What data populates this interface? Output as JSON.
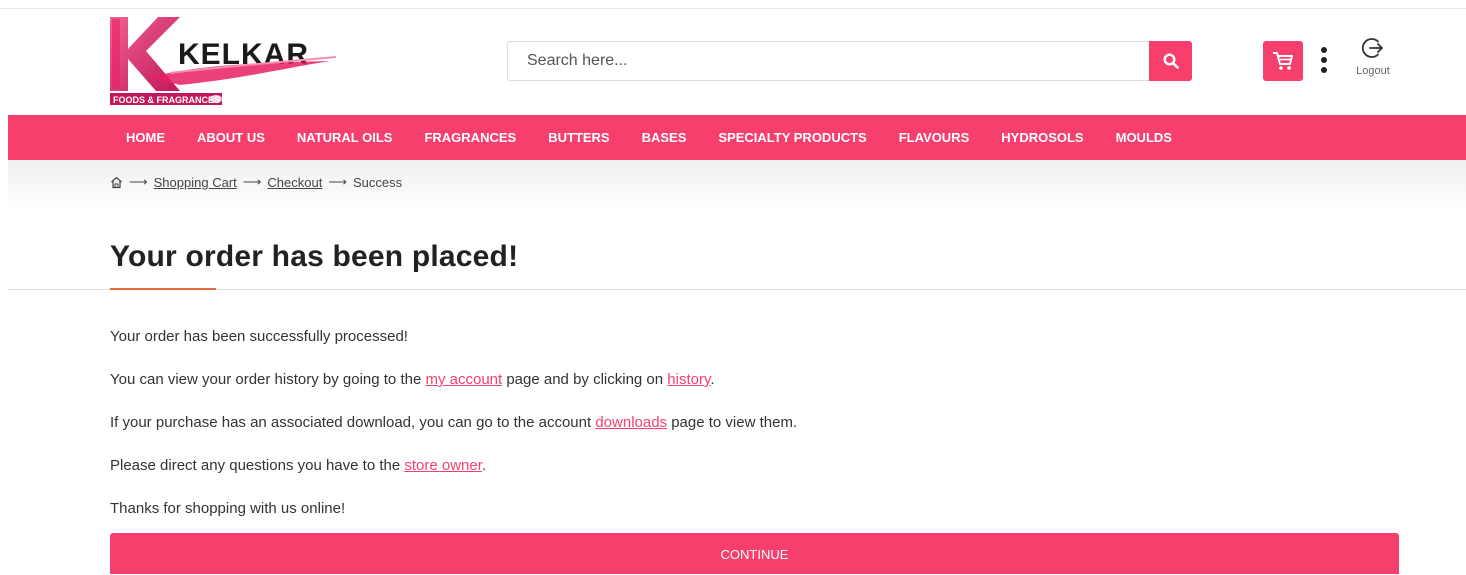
{
  "header": {
    "logo_text": "KELKAR",
    "logo_tagline": "FOODS & FRAGRANCES",
    "search_placeholder": "Search here...",
    "logout_label": "Logout"
  },
  "nav": {
    "items": [
      "HOME",
      "ABOUT US",
      "NATURAL OILS",
      "FRAGRANCES",
      "BUTTERS",
      "BASES",
      "SPECIALTY PRODUCTS",
      "FLAVOURS",
      "HYDROSOLS",
      "MOULDS"
    ]
  },
  "breadcrumb": {
    "items": [
      "Shopping Cart",
      "Checkout",
      "Success"
    ]
  },
  "page": {
    "title": "Your order has been placed!",
    "p1": "Your order has been successfully processed!",
    "p2_pre": "You can view your order history by going to the ",
    "p2_link1": "my account",
    "p2_mid": " page and by clicking on ",
    "p2_link2": "history",
    "p2_post": ".",
    "p3_pre": "If your purchase has an associated download, you can go to the account ",
    "p3_link": "downloads",
    "p3_post": " page to view them.",
    "p4_pre": "Please direct any questions you have to the ",
    "p4_link": "store owner",
    "p4_post": ".",
    "p5": "Thanks for shopping with us online!",
    "continue_label": "CONTINUE"
  },
  "colors": {
    "brand_pink": "#f73f6e",
    "accent_orange": "#e56a3c"
  }
}
